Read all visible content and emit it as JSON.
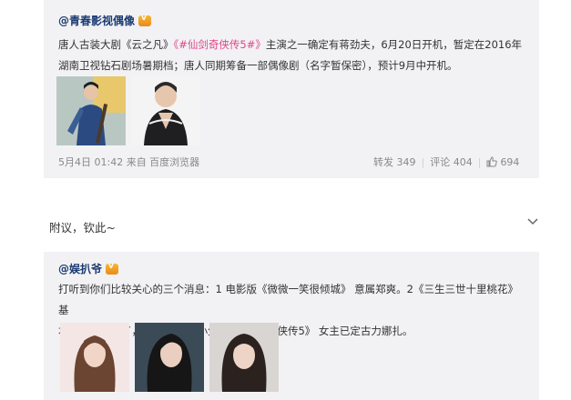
{
  "post1": {
    "author": "@青春影视偶像",
    "text_line1_a": "唐人古装大剧《云之凡》",
    "text_line1_link": "《#仙剑奇侠传5#》",
    "text_line1_b": "主演之一确定有蒋劲夫，6月20日开机，暂定在2016年",
    "text_line2": "湖南卫视钻石剧场暑期档；唐人同期筹备一部偶像剧（名字暂保密），预计9月中开机。",
    "time": "5月4日 01:42 来自 百度浏览器",
    "repost": "转发 349",
    "comment": "评论 404",
    "like": "694"
  },
  "comment_text": "附议，钦此~",
  "post2": {
    "author": "@娱扒爷",
    "text_line1": "打听到你们比较关心的三个消息：1 电影版《微微一笑很倾城》 意属郑爽。2《三生三世十里桃花》 基",
    "text_line2": "本上是刘亦菲了，男主是80后小生。3《仙剑奇侠传5》 女主已定古力娜扎。"
  },
  "icons": {
    "verified": "verified-crown-icon",
    "like": "thumbs-up-icon",
    "expand": "chevron-down-icon"
  }
}
